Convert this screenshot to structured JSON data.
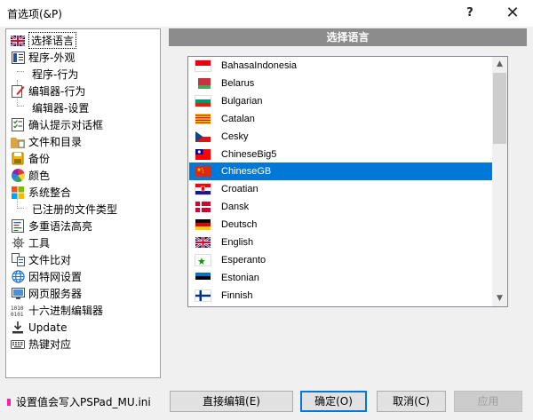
{
  "window": {
    "title": "首选项(&P)",
    "help_label": "?",
    "close_label": "✕"
  },
  "tree": {
    "items": [
      {
        "label": "选择语言",
        "icon": "uk-flag-icon"
      },
      {
        "label": "程序-外观",
        "icon": "program-appearance-icon"
      },
      {
        "label": "程序-行为",
        "icon": ""
      },
      {
        "label": "编辑器-行为",
        "icon": "editor-behavior-icon"
      },
      {
        "label": "编辑器-设置",
        "icon": ""
      },
      {
        "label": "确认提示对话框",
        "icon": "confirm-dialog-icon"
      },
      {
        "label": "文件和目录",
        "icon": "folder-icon"
      },
      {
        "label": "备份",
        "icon": "backup-icon"
      },
      {
        "label": "颜色",
        "icon": "color-wheel-icon"
      },
      {
        "label": "系统整合",
        "icon": "windows-logo-icon"
      },
      {
        "label": "已注册的文件类型",
        "icon": ""
      },
      {
        "label": "多重语法高亮",
        "icon": "syntax-highlight-icon"
      },
      {
        "label": "工具",
        "icon": "gear-icon"
      },
      {
        "label": "文件比对",
        "icon": "file-compare-icon"
      },
      {
        "label": "因特网设置",
        "icon": "globe-icon"
      },
      {
        "label": "网页服务器",
        "icon": "monitor-icon"
      },
      {
        "label": "十六进制编辑器",
        "icon": "hex-icon"
      },
      {
        "label": "Update",
        "icon": "download-icon"
      },
      {
        "label": "热键对应",
        "icon": "keyboard-icon"
      }
    ]
  },
  "panel": {
    "header": "选择语言"
  },
  "languages": [
    {
      "name": "BahasaIndonesia",
      "flag": "indonesia"
    },
    {
      "name": "Belarus",
      "flag": "belarus"
    },
    {
      "name": "Bulgarian",
      "flag": "bulgaria"
    },
    {
      "name": "Catalan",
      "flag": "catalonia"
    },
    {
      "name": "Cesky",
      "flag": "czech"
    },
    {
      "name": "ChineseBig5",
      "flag": "taiwan"
    },
    {
      "name": "ChineseGB",
      "flag": "china",
      "selected": true
    },
    {
      "name": "Croatian",
      "flag": "croatia"
    },
    {
      "name": "Dansk",
      "flag": "denmark"
    },
    {
      "name": "Deutsch",
      "flag": "germany"
    },
    {
      "name": "English",
      "flag": "uk"
    },
    {
      "name": "Esperanto",
      "flag": "esperanto"
    },
    {
      "name": "Estonian",
      "flag": "estonia"
    },
    {
      "name": "Finnish",
      "flag": "finland"
    }
  ],
  "footer": {
    "note": "设置值会写入PSPad_MU.ini",
    "btn_direct_edit": "直接编辑(E)",
    "btn_ok": "确定(O)",
    "btn_cancel": "取消(C)",
    "btn_apply": "应用"
  },
  "colors": {
    "selection": "#0078d7",
    "header_bg": "#8c8c8c",
    "note_mark": "#ff1fa8"
  }
}
